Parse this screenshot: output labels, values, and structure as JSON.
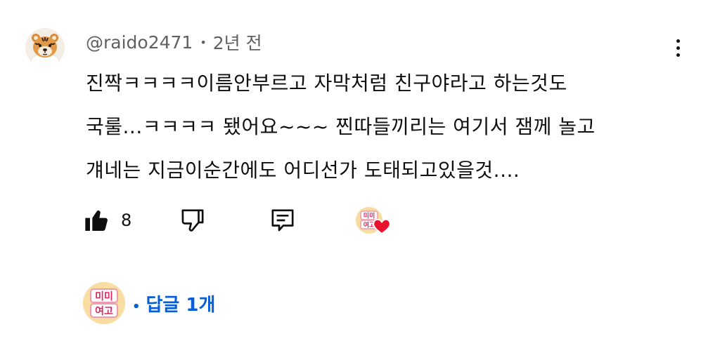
{
  "comment": {
    "author": "@raido2471",
    "timestamp": "2년 전",
    "text_lines": [
      "진짝ㅋㅋㅋㅋ이름안부르고 자막처럼 친구야라고 하는것도",
      "국룰...ㅋㅋㅋㅋ 됐어요~~~ 찐따들끼리는 여기서 잼께 놀고",
      "걔네는 지금이순간에도 어디선가 도태되고있을것...."
    ],
    "like_count": "8",
    "avatar_icon": "tiger-plush-avatar",
    "more_icon": "more-vertical-icon"
  },
  "actions": {
    "like_icon": "thumbs-up-filled-icon",
    "dislike_icon": "thumbs-down-icon",
    "reply_icon": "reply-comment-icon",
    "creator_heart_icon": "creator-heart-icon"
  },
  "replies": {
    "separator": "•",
    "label": "답글 1개"
  },
  "badge": {
    "line1": "미미",
    "line2": "여고"
  },
  "colors": {
    "link_blue": "#065fd4",
    "heart_red": "#e8122e",
    "meta_gray": "#606060",
    "badge_bg": "#f7e1a6",
    "badge_text": "#e0245e"
  }
}
